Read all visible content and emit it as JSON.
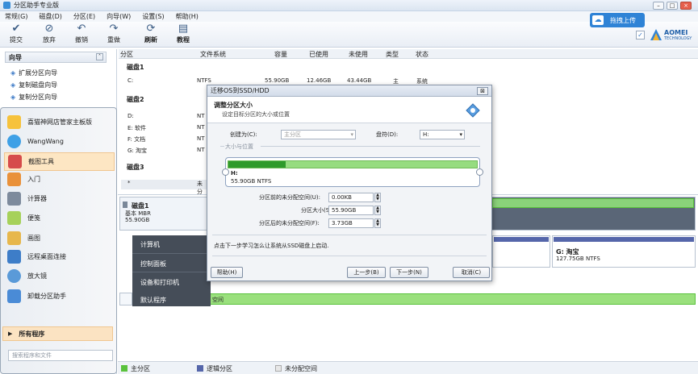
{
  "app": {
    "title": "分区助手专业版"
  },
  "menu": [
    "常规(G)",
    "磁盘(D)",
    "分区(E)",
    "向导(W)",
    "设置(S)",
    "帮助(H)"
  ],
  "toolbar": {
    "buttons": [
      {
        "label": "提交",
        "icon": "check-icon"
      },
      {
        "label": "放弃",
        "icon": "discard-icon"
      },
      {
        "label": "撤销",
        "icon": "undo-icon"
      },
      {
        "label": "重做",
        "icon": "redo-icon"
      },
      {
        "label": "刷新",
        "icon": "refresh-icon"
      },
      {
        "label": "教程",
        "icon": "tutorial-icon"
      }
    ],
    "upload_label": "拖拽上传",
    "brand_name": "AOMEI",
    "brand_sub": "TECHNOLOGY"
  },
  "wizard": {
    "title": "向导",
    "items": [
      "扩展分区向导",
      "复制磁盘向导",
      "复制分区向导"
    ]
  },
  "startmenu": {
    "items": [
      {
        "label": "喜猫神网店管家主板版"
      },
      {
        "label": "WangWang"
      },
      {
        "label": "截图工具"
      },
      {
        "label": "入门"
      },
      {
        "label": "计算器"
      },
      {
        "label": "便笺"
      },
      {
        "label": "画图"
      },
      {
        "label": "远程桌面连接"
      },
      {
        "label": "放大镜"
      },
      {
        "label": "卸载分区助手"
      }
    ],
    "all_programs": "所有程序",
    "search_placeholder": "搜索程序和文件",
    "submenu": [
      "计算机",
      "控制面板",
      "设备和打印机",
      "默认程序"
    ]
  },
  "grid": {
    "headers": [
      "分区",
      "文件系统",
      "容量",
      "已使用",
      "未使用",
      "类型",
      "状态"
    ],
    "disk1": {
      "title": "磁盘1",
      "rows": [
        {
          "part": "C:",
          "fs": "NTFS",
          "cap": "55.90GB",
          "used": "12.46GB",
          "free": "43.44GB",
          "type": "主",
          "status": "系统"
        }
      ]
    },
    "disk2": {
      "title": "磁盘2",
      "rows": [
        {
          "part": "D:",
          "fs": "NT"
        },
        {
          "part": "E: 软件",
          "fs": "NT"
        },
        {
          "part": "F: 文档",
          "fs": "NT"
        },
        {
          "part": "G: 淘宝",
          "fs": "NT"
        }
      ]
    },
    "disk3": {
      "title": "磁盘3",
      "rows": [
        {
          "part": "*",
          "fs": "未分"
        }
      ]
    }
  },
  "diskmap": {
    "disk1": {
      "name": "磁盘1",
      "type": "基本 MBR",
      "size": "55.90GB"
    },
    "g_partition": {
      "name": "G: 淘宝",
      "detail": "127.75GB NTFS"
    },
    "unalloc_label": "空间"
  },
  "status": {
    "primary": "主分区",
    "logical": "逻辑分区",
    "unallocated": "未分配空间"
  },
  "colors": {
    "primary": "#5ac23c",
    "logical": "#5566aa",
    "unallocated": "#e7e7e7",
    "accent": "#2f83d6"
  },
  "dialog": {
    "title": "迁移OS到SSD/HDD",
    "heading": "调整分区大小",
    "subheading": "设定目标分区的大小或位置",
    "create_as_label": "创建为(C):",
    "create_as_value": "主分区",
    "drive_letter_label": "盘符(D):",
    "drive_letter_value": "H:",
    "group_label": "大小与位置",
    "partition_label": "H:",
    "partition_detail": "55.90GB NTFS",
    "partition_fill": 0.23,
    "before_label": "分区前的未分配空间(U):",
    "before_value": "0.00KB",
    "size_label": "分区大小(S):",
    "size_value": "55.90GB",
    "after_label": "分区后的未分配空间(F):",
    "after_value": "3.73GB",
    "hint": "点击下一步学习怎么让系统从SSD磁盘上启动.",
    "help_button": "帮助(H)",
    "back_button": "上一步(B)",
    "next_button": "下一步(N)",
    "cancel_button": "取消(C)"
  }
}
